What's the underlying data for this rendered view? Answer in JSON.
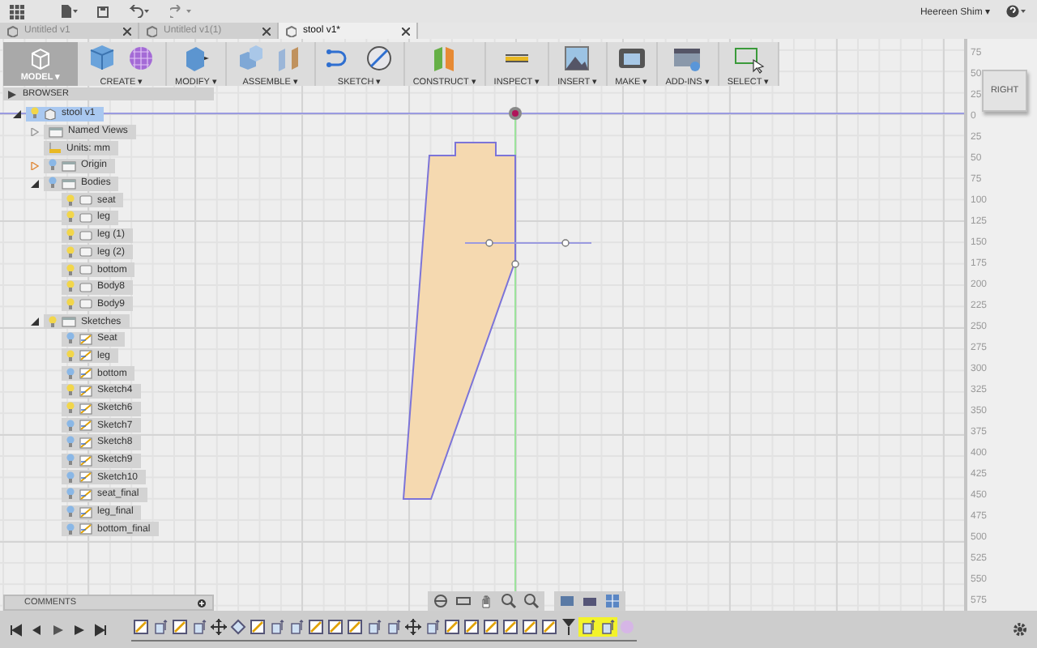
{
  "top_bar": {
    "user": "Heereen Shim ▾"
  },
  "tabs": [
    {
      "label": "Untitled v1",
      "selected": false
    },
    {
      "label": "Untitled v1(1)",
      "selected": false
    },
    {
      "label": "stool v1*",
      "selected": true
    }
  ],
  "toolbar": {
    "workspace": "MODEL ▾",
    "groups": [
      {
        "label": "CREATE ▾",
        "kind": "create"
      },
      {
        "label": "MODIFY ▾",
        "kind": "modify"
      },
      {
        "label": "ASSEMBLE ▾",
        "kind": "assemble"
      },
      {
        "label": "SKETCH ▾",
        "kind": "sketch"
      },
      {
        "label": "CONSTRUCT ▾",
        "kind": "construct"
      },
      {
        "label": "INSPECT ▾",
        "kind": "inspect"
      },
      {
        "label": "INSERT ▾",
        "kind": "insert"
      },
      {
        "label": "MAKE ▾",
        "kind": "make"
      },
      {
        "label": "ADD-INS ▾",
        "kind": "addins"
      },
      {
        "label": "SELECT ▾",
        "kind": "select"
      }
    ]
  },
  "browser": {
    "title": "BROWSER",
    "tree": [
      {
        "label": "stool v1",
        "kind": "component",
        "visible": true,
        "expanded": true,
        "selected": true,
        "children": [
          {
            "label": "Named Views",
            "kind": "views",
            "expanded": false,
            "selected": false
          },
          {
            "label": "Units: mm",
            "kind": "units",
            "selected": false
          },
          {
            "label": "Origin",
            "kind": "folder",
            "visible": false,
            "expanded": false,
            "selected": false
          },
          {
            "label": "Bodies",
            "kind": "folder",
            "visible": false,
            "expanded": true,
            "selected": false,
            "children": [
              {
                "label": "seat",
                "kind": "body",
                "visible": true,
                "selected": false
              },
              {
                "label": "leg",
                "kind": "body",
                "visible": true,
                "selected": false
              },
              {
                "label": "leg (1)",
                "kind": "body",
                "visible": true,
                "selected": false
              },
              {
                "label": "leg (2)",
                "kind": "body",
                "visible": true,
                "selected": false
              },
              {
                "label": "bottom",
                "kind": "body",
                "visible": true,
                "selected": false
              },
              {
                "label": "Body8",
                "kind": "body",
                "visible": true,
                "selected": false
              },
              {
                "label": "Body9",
                "kind": "body",
                "visible": true,
                "selected": false
              }
            ]
          },
          {
            "label": "Sketches",
            "kind": "folder",
            "visible": true,
            "expanded": true,
            "selected": false,
            "children": [
              {
                "label": "Seat",
                "kind": "sketch",
                "visible": false,
                "selected": false
              },
              {
                "label": "leg",
                "kind": "sketch",
                "visible": true,
                "selected": false
              },
              {
                "label": "bottom",
                "kind": "sketch",
                "visible": false,
                "selected": false
              },
              {
                "label": "Sketch4",
                "kind": "sketch",
                "visible": true,
                "selected": false
              },
              {
                "label": "Sketch6",
                "kind": "sketch",
                "visible": true,
                "selected": false
              },
              {
                "label": "Sketch7",
                "kind": "sketch",
                "visible": false,
                "selected": false
              },
              {
                "label": "Sketch8",
                "kind": "sketch",
                "visible": false,
                "selected": false
              },
              {
                "label": "Sketch9",
                "kind": "sketch",
                "visible": false,
                "selected": false
              },
              {
                "label": "Sketch10",
                "kind": "sketch",
                "visible": false,
                "selected": false
              },
              {
                "label": "seat_final",
                "kind": "sketch",
                "visible": false,
                "selected": false
              },
              {
                "label": "leg_final",
                "kind": "sketch",
                "visible": false,
                "selected": false
              },
              {
                "label": "bottom_final",
                "kind": "sketch",
                "visible": false,
                "selected": false
              }
            ]
          }
        ]
      }
    ]
  },
  "comments": {
    "title": "COMMENTS"
  },
  "view_cube": {
    "label": "RIGHT"
  },
  "ruler": [
    "75",
    "50",
    "25",
    "0",
    "25",
    "50",
    "75",
    "100",
    "125",
    "150",
    "175",
    "200",
    "225",
    "250",
    "275",
    "300",
    "325",
    "350",
    "375",
    "400",
    "425",
    "450",
    "475",
    "500",
    "525",
    "550",
    "575"
  ],
  "timeline": [
    {
      "kind": "sketch",
      "selected": false
    },
    {
      "kind": "extrude",
      "selected": false
    },
    {
      "kind": "sketch",
      "selected": false
    },
    {
      "kind": "extrude",
      "selected": false
    },
    {
      "kind": "move",
      "selected": false
    },
    {
      "kind": "joint",
      "selected": false
    },
    {
      "kind": "sketch",
      "selected": false
    },
    {
      "kind": "extrude",
      "selected": false
    },
    {
      "kind": "extrude",
      "selected": false
    },
    {
      "kind": "sketch",
      "selected": false
    },
    {
      "kind": "sketch",
      "selected": false
    },
    {
      "kind": "sketch",
      "selected": false
    },
    {
      "kind": "extrude",
      "selected": false
    },
    {
      "kind": "extrude",
      "selected": false
    },
    {
      "kind": "move",
      "selected": false
    },
    {
      "kind": "extrude",
      "selected": false
    },
    {
      "kind": "sketch",
      "selected": false
    },
    {
      "kind": "sketch",
      "selected": false
    },
    {
      "kind": "sketch",
      "selected": false
    },
    {
      "kind": "sketch",
      "selected": false
    },
    {
      "kind": "sketch",
      "selected": false
    },
    {
      "kind": "sketch",
      "selected": false
    },
    {
      "kind": "marker",
      "selected": false
    },
    {
      "kind": "extrude",
      "selected": true
    },
    {
      "kind": "extrude",
      "selected": true
    },
    {
      "kind": "form",
      "selected": false
    }
  ]
}
